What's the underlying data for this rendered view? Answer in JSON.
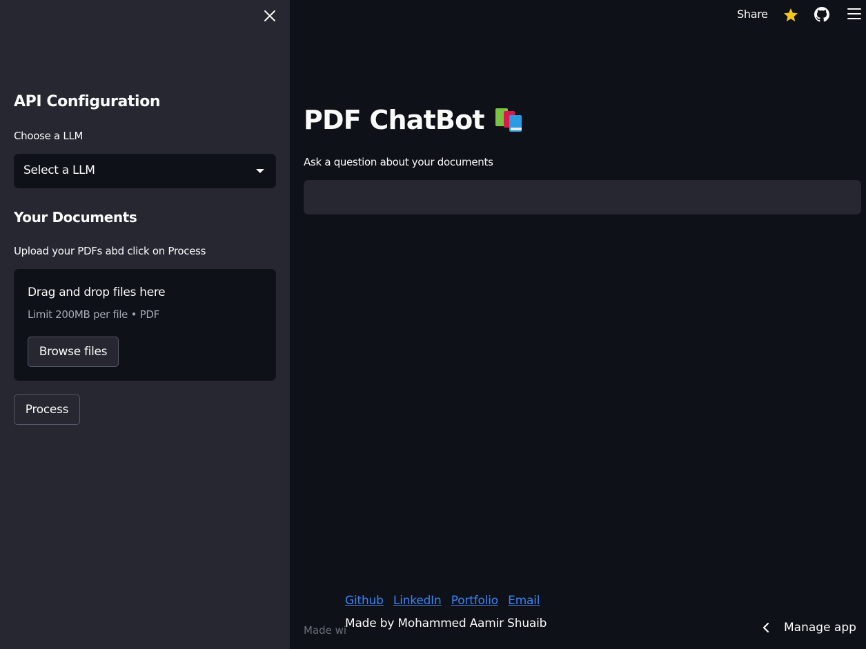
{
  "sidebar": {
    "api_heading": "API Configuration",
    "llm_label": "Choose a LLM",
    "llm_select_value": "Select a LLM",
    "docs_heading": "Your Documents",
    "upload_label": "Upload your PDFs abd click on Process",
    "dropzone_title": "Drag and drop files here",
    "dropzone_limit": "Limit 200MB per file • PDF",
    "browse_button": "Browse files",
    "process_button": "Process"
  },
  "topbar": {
    "share": "Share",
    "icons": [
      "star-icon",
      "github-icon",
      "hamburger-menu-icon"
    ]
  },
  "main": {
    "title": "PDF ChatBot",
    "title_icon": "books-icon",
    "question_label": "Ask a question about your documents",
    "question_value": ""
  },
  "footer": {
    "links": [
      "Github",
      "LinkedIn",
      "Portfolio",
      "Email"
    ],
    "made_with": "Made wi",
    "made_by": "Made by Mohammed Aamir Shuaib",
    "manage_app": "Manage app"
  },
  "colors": {
    "sidebar_bg": "#262730",
    "main_bg": "#0e1117",
    "link": "#3b82f6",
    "star": "#f5c518"
  }
}
